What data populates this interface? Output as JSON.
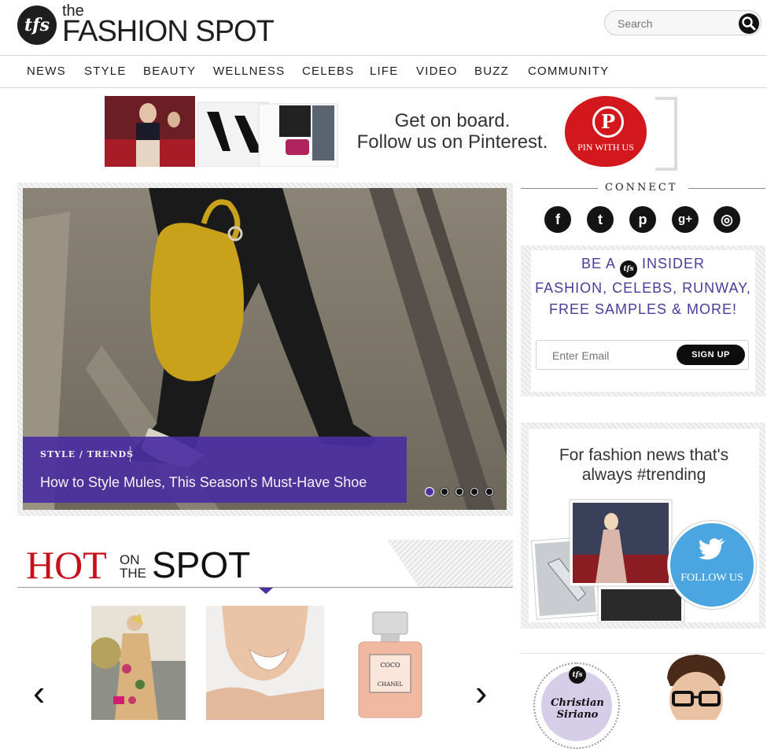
{
  "brand": {
    "logo_initials": "tfs",
    "logo_the": "the",
    "logo_word": "FASHION SPOT"
  },
  "search": {
    "placeholder": "Search",
    "icon": "magnifier-icon"
  },
  "nav": {
    "items": [
      "NEWS",
      "STYLE",
      "BEAUTY",
      "WELLNESS",
      "CELEBS",
      "LIFE",
      "VIDEO",
      "BUZZ",
      "COMMUNITY"
    ]
  },
  "pinterest_banner": {
    "line1": "Get on board.",
    "line2": "Follow us on Pinterest.",
    "button_label": "PIN WITH US",
    "button_color": "#d2181d"
  },
  "hero": {
    "category": "STYLE / TRENDS",
    "title": "How to Style Mules, This Season's Must-Have Shoe",
    "slides_total": 5,
    "active_slide": 1,
    "caption_color": "#4a2fa0"
  },
  "hot_on_the_spot": {
    "hot": "HOT",
    "on": "ON",
    "the": "THE",
    "spot": "SPOT",
    "prev": "‹",
    "next": "›"
  },
  "sidebar": {
    "connect_title": "CONNECT",
    "social_icons": [
      "facebook-icon",
      "twitter-icon",
      "pinterest-icon",
      "google-plus-icon",
      "instagram-icon"
    ],
    "social_glyphs": [
      "f",
      "t",
      "p",
      "g+",
      "◎"
    ],
    "insider": {
      "line1_pre": "BE A",
      "line1_logo": "tfs",
      "line1_post": "INSIDER",
      "line2": "FASHION, CELEBS, RUNWAY,",
      "line3": "FREE SAMPLES & MORE!",
      "email_placeholder": "Enter Email",
      "signup_label": "SIGN UP"
    },
    "twitter_promo": {
      "line1": "For fashion news that's",
      "line2": "always #trending",
      "button_label": "FOLLOW US",
      "button_color": "#4ba5e0"
    },
    "siriano": {
      "logo": "tfs",
      "name": "Christian Siriano"
    }
  }
}
